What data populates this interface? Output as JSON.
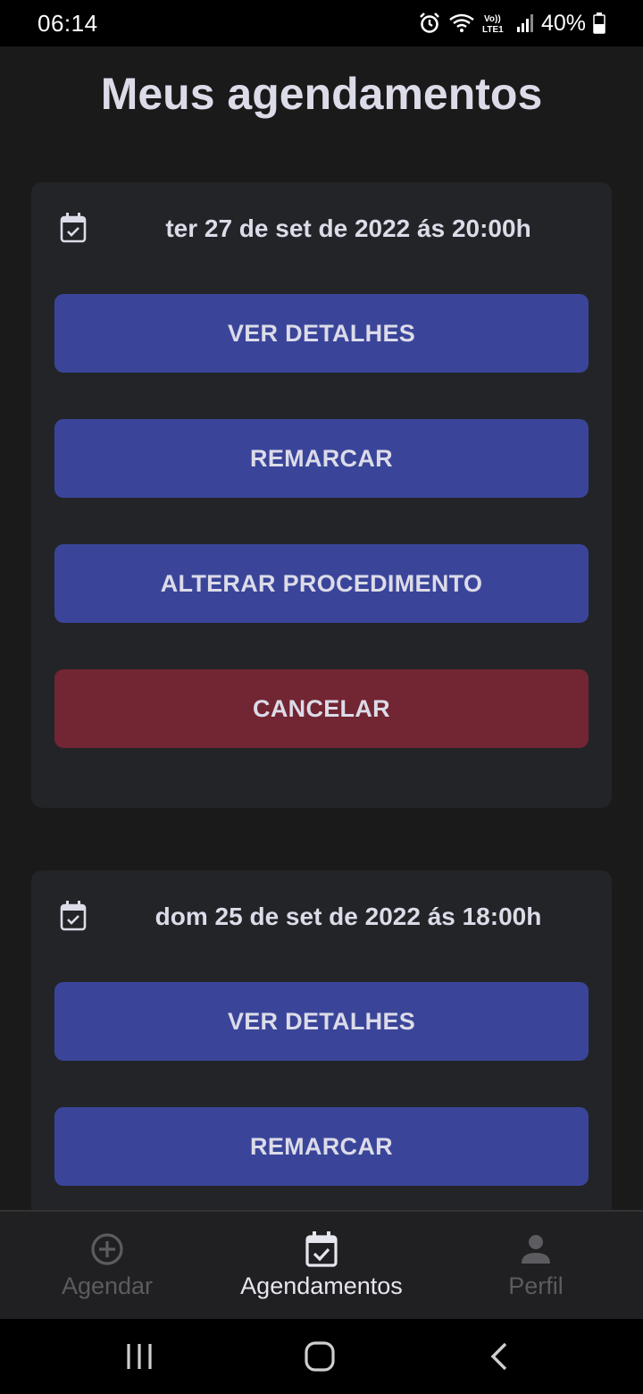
{
  "status_bar": {
    "time": "06:14",
    "battery": "40%",
    "icons": [
      "alarm-icon",
      "wifi-icon",
      "volte-icon",
      "signal-icon",
      "battery-icon"
    ]
  },
  "page": {
    "title": "Meus agendamentos"
  },
  "appointments": [
    {
      "date": "ter 27 de set de 2022 ás 20:00h",
      "actions": {
        "details": "VER DETALHES",
        "reschedule": "REMARCAR",
        "change_procedure": "ALTERAR PROCEDIMENTO",
        "cancel": "CANCELAR"
      }
    },
    {
      "date": "dom 25 de set de 2022 ás 18:00h",
      "actions": {
        "details": "VER DETALHES",
        "reschedule": "REMARCAR"
      }
    }
  ],
  "bottom_nav": {
    "items": [
      {
        "label": "Agendar",
        "icon": "add-circle-icon"
      },
      {
        "label": "Agendamentos",
        "icon": "calendar-check-icon"
      },
      {
        "label": "Perfil",
        "icon": "person-icon"
      }
    ],
    "active": "Agendamentos"
  },
  "colors": {
    "background": "#1a1a1b",
    "card": "#232427",
    "primary_button": "#3a459a",
    "danger_button": "#722532",
    "text": "#dcdbe8"
  }
}
